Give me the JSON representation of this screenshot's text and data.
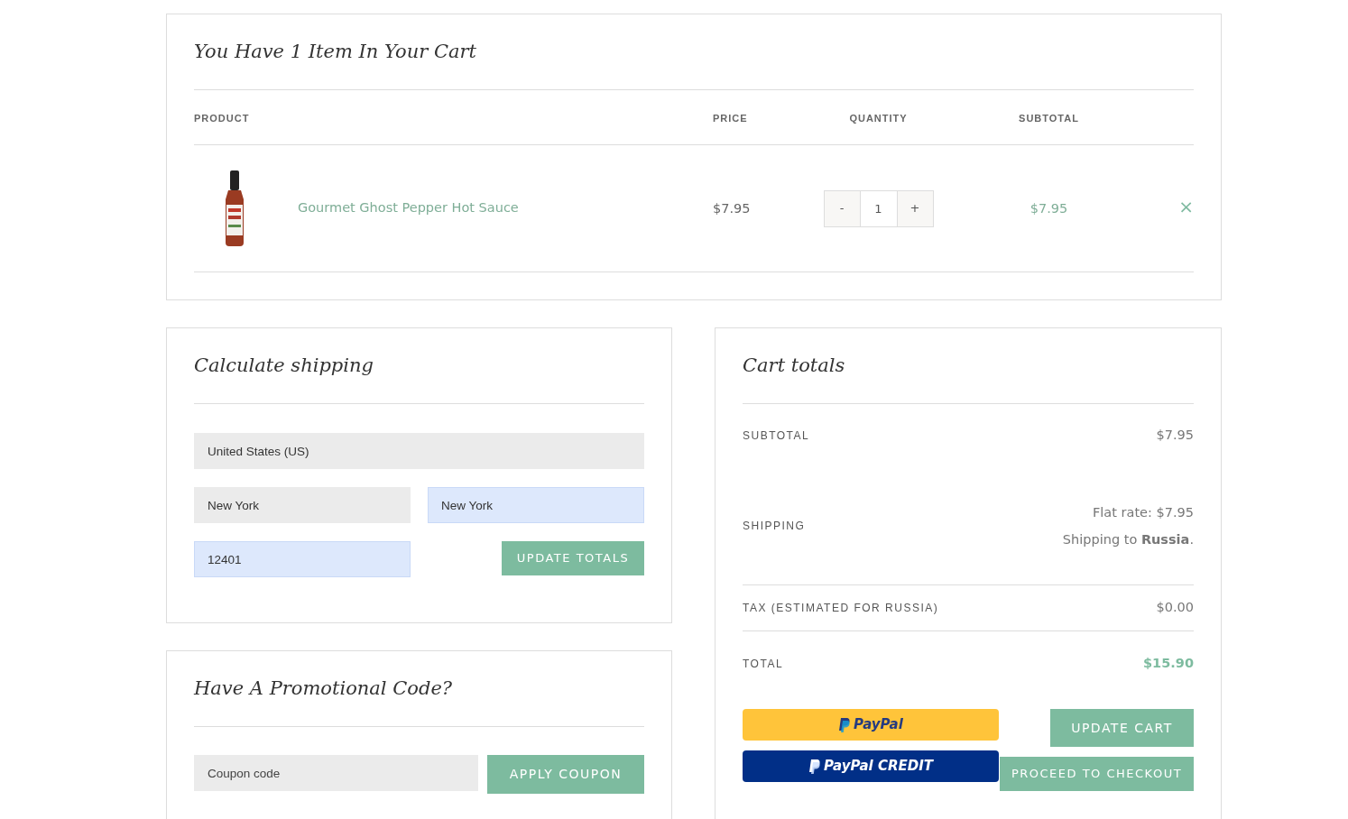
{
  "cart": {
    "title": "You Have 1 Item In Your Cart",
    "columns": [
      "PRODUCT",
      "PRICE",
      "QUANTITY",
      "SUBTOTAL"
    ],
    "items": [
      {
        "name": "Gourmet Ghost Pepper Hot Sauce",
        "price": "$7.95",
        "quantity": "1",
        "decrease": "-",
        "increase": "+",
        "subtotal": "$7.95",
        "remove": "×"
      }
    ]
  },
  "shipping_calculator": {
    "title": "Calculate shipping",
    "fields": [
      {
        "value": "United States (US)",
        "autofilled": false
      },
      {
        "value": "New York",
        "autofilled": false
      },
      {
        "value": "New York",
        "autofilled": true
      },
      {
        "value": "12401",
        "autofilled": true
      }
    ],
    "button": "UPDATE TOTALS"
  },
  "promo": {
    "title": "Have A Promotional Code?",
    "placeholder": "Coupon code",
    "button": "APPLY COUPON"
  },
  "totals": {
    "title": "Cart totals",
    "rows": [
      {
        "kind": "plain",
        "label": "SUBTOTAL",
        "value": "$7.95"
      },
      {
        "kind": "shipping",
        "label": "SHIPPING",
        "lines": [
          "Flat rate: $7.95",
          "Shipping to **Russia**."
        ]
      },
      {
        "kind": "plain",
        "label": "TAX (ESTIMATED FOR RUSSIA)",
        "value": "$0.00"
      },
      {
        "kind": "total",
        "label": "TOTAL",
        "value": "$15.90"
      }
    ],
    "paypal_buttons": [
      {
        "kind": "paypal",
        "label": "PayPal"
      },
      {
        "kind": "credit",
        "label": "PayPal CREDIT"
      }
    ],
    "update_button": "UPDATE CART",
    "checkout_button": "PROCEED TO CHECKOUT"
  }
}
